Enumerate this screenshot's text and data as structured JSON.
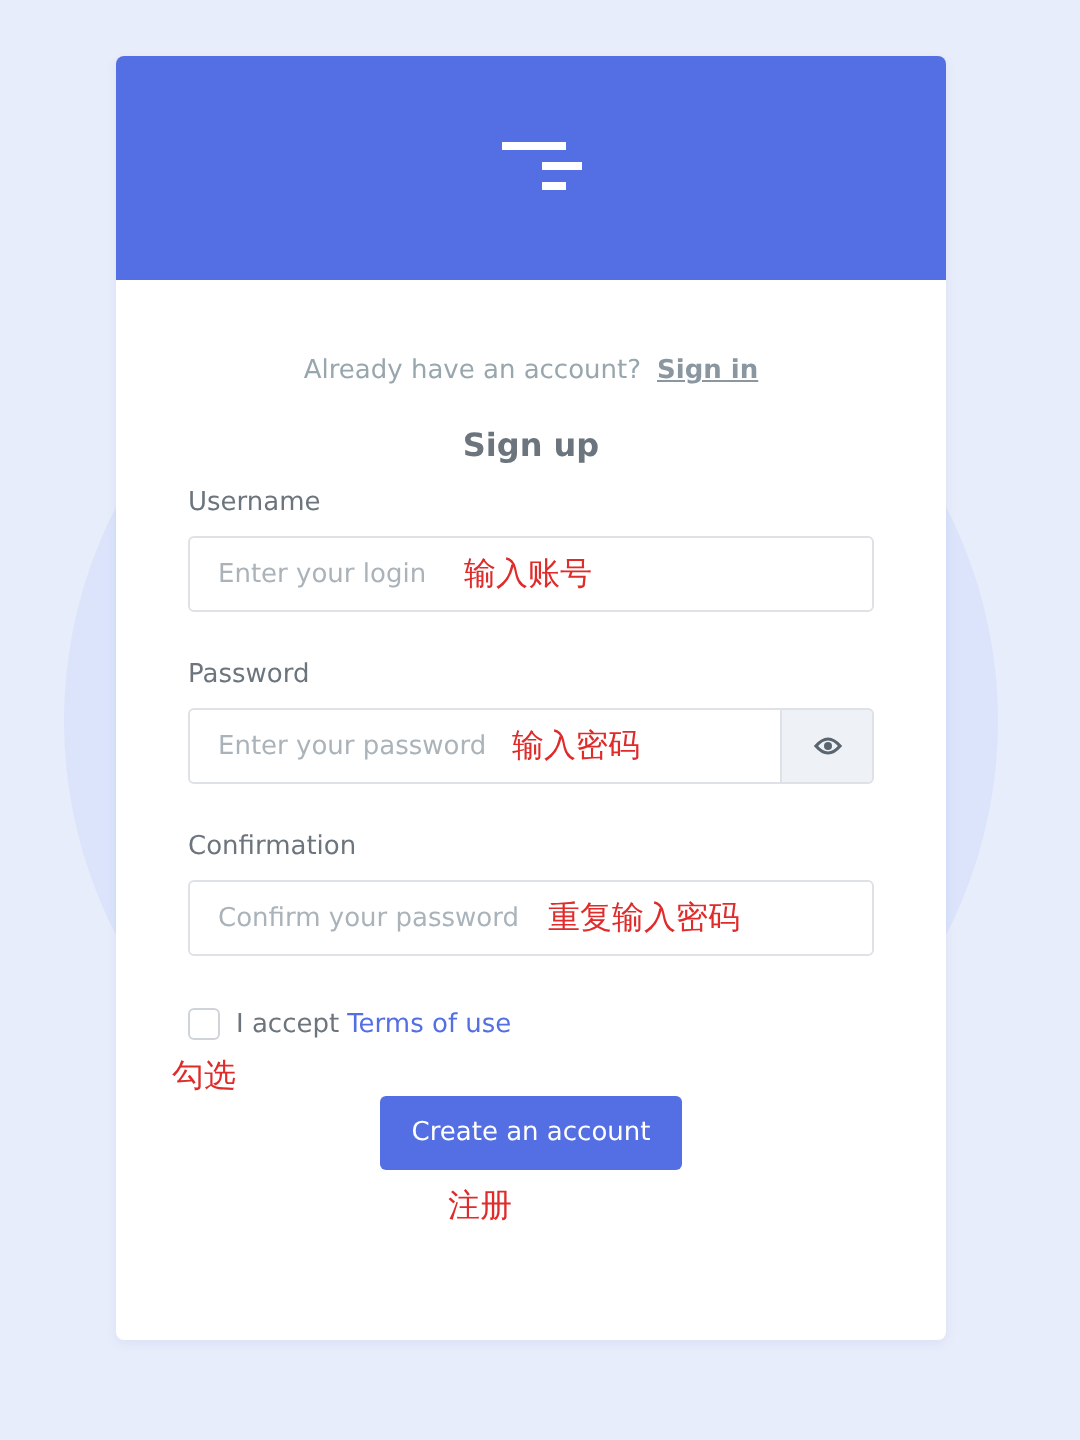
{
  "signin_prompt": {
    "text": "Already have an account?",
    "link": "Sign in"
  },
  "title": "Sign up",
  "fields": [
    {
      "label": "Username",
      "placeholder": "Enter your login",
      "kind": "text",
      "annotation": "输入账号"
    },
    {
      "label": "Password",
      "placeholder": "Enter your password",
      "kind": "password",
      "annotation": "输入密码"
    },
    {
      "label": "Confirmation",
      "placeholder": "Confirm your password",
      "kind": "text",
      "annotation": "重复输入密码"
    }
  ],
  "terms": {
    "checked": false,
    "text": "I accept",
    "link": "Terms of use",
    "annotation": "勾选"
  },
  "submit": {
    "label": "Create an account",
    "annotation": "注册"
  }
}
